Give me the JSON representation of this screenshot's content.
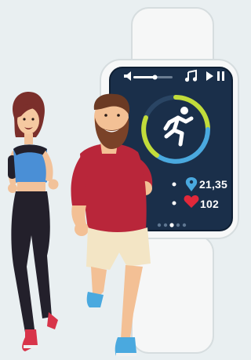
{
  "watch": {
    "controls": {
      "volume_icon": "speaker-icon",
      "music_icon": "music-note-icon",
      "play_icon": "play-icon",
      "pause_icon": "pause-icon",
      "volume_level": 0.55
    },
    "activity_icon": "running-person-icon",
    "stats": {
      "distance": "21,35",
      "distance_icon": "location-pin-icon",
      "heart_rate": "102",
      "heart_icon": "heart-icon"
    },
    "page_dots": 5,
    "active_dot": 2
  },
  "colors": {
    "background": "#e9eff1",
    "screen": "#1a2f4a",
    "strap": "#f4f5f5",
    "accent_green": "#c2dc3a",
    "accent_blue": "#4aa9df",
    "heart_red": "#e2283a",
    "man_shirt": "#b9263a",
    "woman_top": "#4a8fd6"
  }
}
